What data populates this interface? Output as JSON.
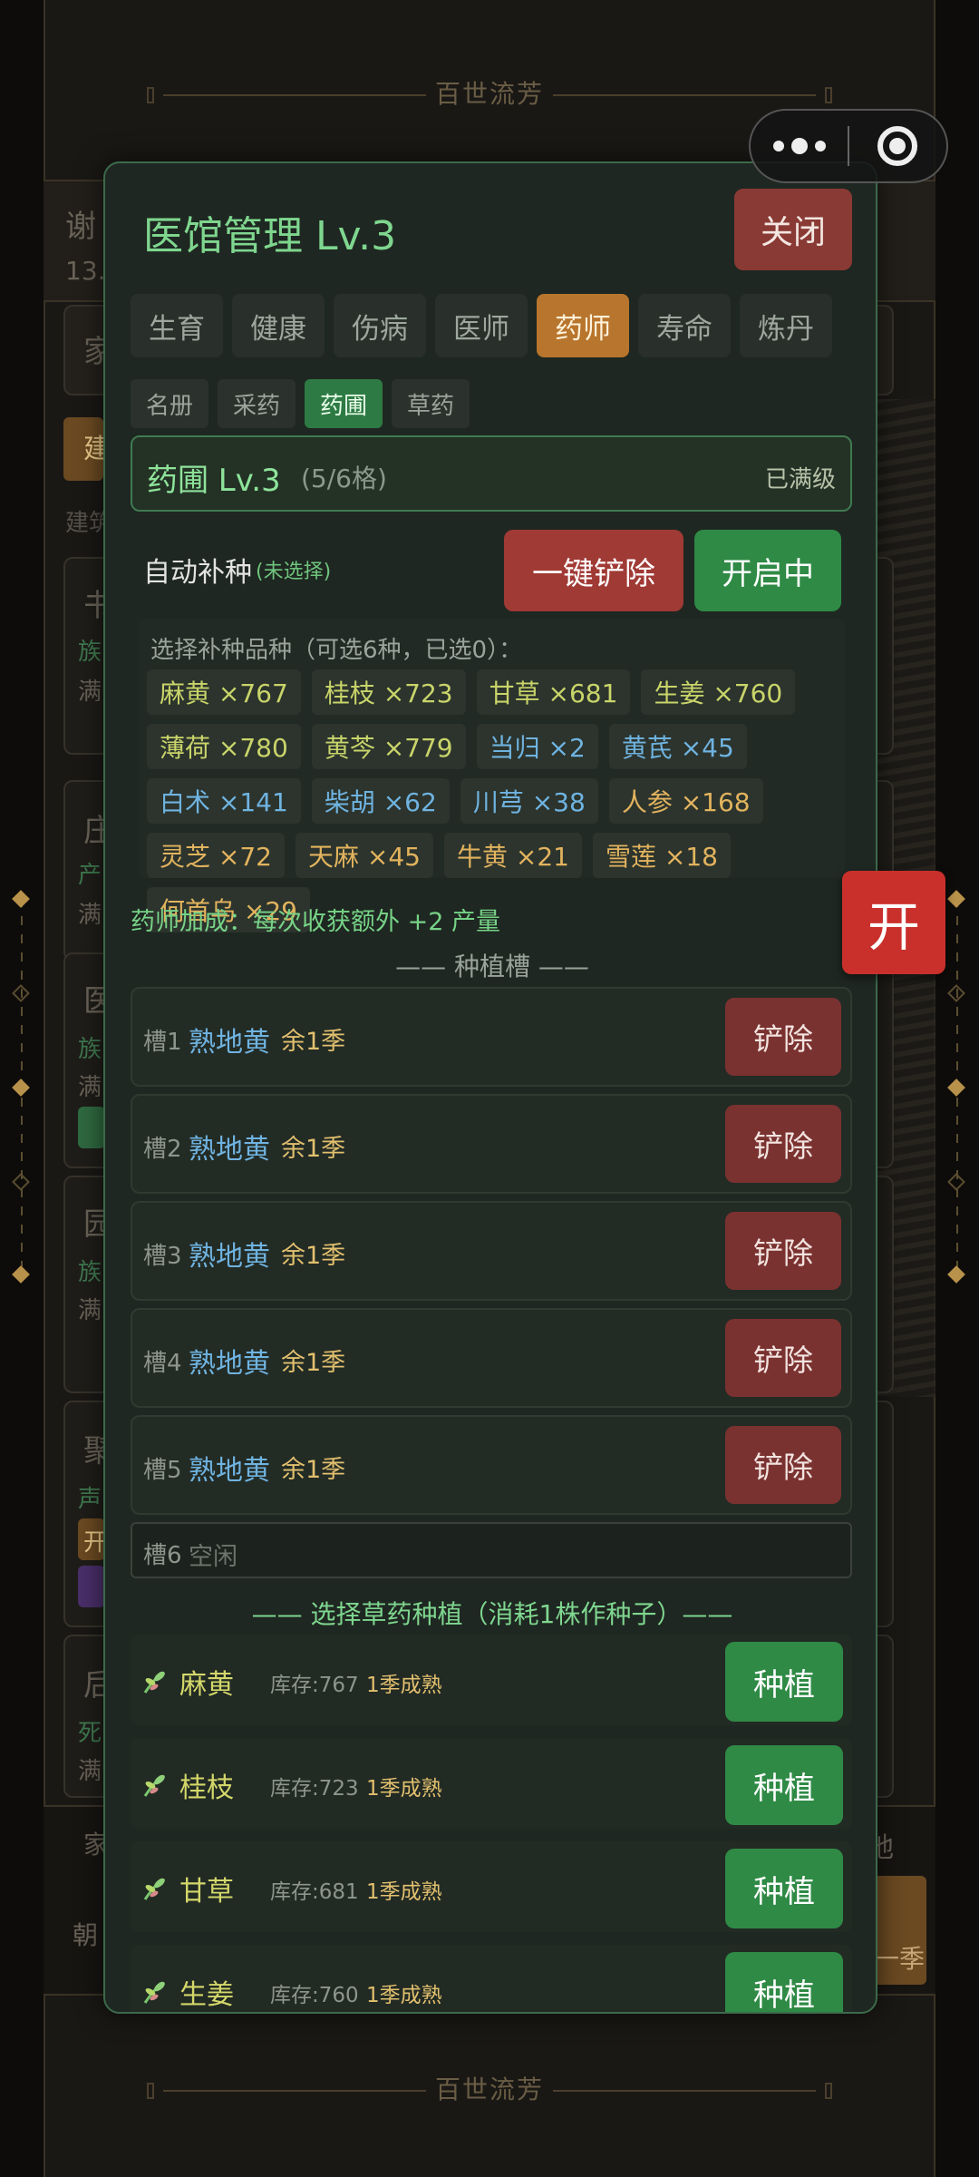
{
  "background": {
    "banner_title": "百世流芳",
    "right_label_bottom": "地",
    "right_label_season": "一季",
    "left_labels": [
      "谢",
      "13.",
      "家",
      "建",
      "建筑",
      "书",
      "族",
      "满",
      "庄",
      "产",
      "满",
      "医",
      "族",
      "满",
      "园",
      "族",
      "满",
      "聚",
      "声",
      "开",
      "后",
      "死",
      "满",
      "家",
      "朝"
    ]
  },
  "float_button": {
    "label": "开"
  },
  "modal": {
    "title": "医馆管理 Lv.3",
    "close_label": "关闭",
    "tabs": [
      "生育",
      "健康",
      "伤病",
      "医师",
      "药师",
      "寿命",
      "炼丹"
    ],
    "active_tab": "药师",
    "subtabs": [
      "名册",
      "采药",
      "药圃",
      "草药"
    ],
    "active_subtab": "药圃",
    "garden": {
      "name": "药圃 Lv.3",
      "capacity": "(5/6格)",
      "max_label": "已满级"
    },
    "auto_replant": {
      "label": "自动补种",
      "status": "(未选择)",
      "clear_button": "一键铲除",
      "toggle_button": "开启中"
    },
    "seed_select": {
      "hint": "选择补种品种（可选6种，已选0）：",
      "seeds": [
        {
          "label": "麻黄 ×767",
          "color": "green"
        },
        {
          "label": "桂枝 ×723",
          "color": "green"
        },
        {
          "label": "甘草 ×681",
          "color": "green"
        },
        {
          "label": "生姜 ×760",
          "color": "green"
        },
        {
          "label": "薄荷 ×780",
          "color": "green"
        },
        {
          "label": "黄芩 ×779",
          "color": "green"
        },
        {
          "label": "当归 ×2",
          "color": "blue"
        },
        {
          "label": "黄芪 ×45",
          "color": "blue"
        },
        {
          "label": "白术 ×141",
          "color": "blue"
        },
        {
          "label": "柴胡 ×62",
          "color": "blue"
        },
        {
          "label": "川芎 ×38",
          "color": "blue"
        },
        {
          "label": "人参 ×168",
          "color": "gold"
        },
        {
          "label": "灵芝 ×72",
          "color": "gold"
        },
        {
          "label": "天麻 ×45",
          "color": "gold"
        },
        {
          "label": "牛黄 ×21",
          "color": "gold"
        },
        {
          "label": "雪莲 ×18",
          "color": "gold"
        },
        {
          "label": "何首乌 ×29",
          "color": "gold"
        }
      ]
    },
    "bonus_text": "药师加成：每次收获额外 +2 产量",
    "slots_title": "—— 种植槽 ——",
    "slots": [
      {
        "name": "槽1",
        "herb": "熟地黄",
        "remaining": "余1季",
        "action": "铲除"
      },
      {
        "name": "槽2",
        "herb": "熟地黄",
        "remaining": "余1季",
        "action": "铲除"
      },
      {
        "name": "槽3",
        "herb": "熟地黄",
        "remaining": "余1季",
        "action": "铲除"
      },
      {
        "name": "槽4",
        "herb": "熟地黄",
        "remaining": "余1季",
        "action": "铲除"
      },
      {
        "name": "槽5",
        "herb": "熟地黄",
        "remaining": "余1季",
        "action": "铲除"
      }
    ],
    "empty_slot": {
      "name": "槽6",
      "status": "空闲"
    },
    "plant_title": "—— 选择草药种植（消耗1株作种子）——",
    "plants": [
      {
        "name": "麻黄",
        "stock": "库存:767",
        "ripe": "1季成熟",
        "action": "种植"
      },
      {
        "name": "桂枝",
        "stock": "库存:723",
        "ripe": "1季成熟",
        "action": "种植"
      },
      {
        "name": "甘草",
        "stock": "库存:681",
        "ripe": "1季成熟",
        "action": "种植"
      },
      {
        "name": "生姜",
        "stock": "库存:760",
        "ripe": "1季成熟",
        "action": "种植"
      }
    ]
  }
}
